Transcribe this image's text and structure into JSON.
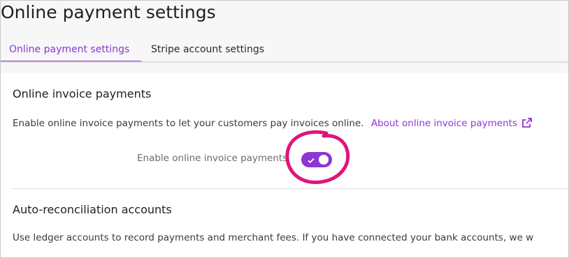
{
  "page": {
    "title": "Online payment settings"
  },
  "tabs": [
    {
      "label": "Online payment settings",
      "active": true
    },
    {
      "label": "Stripe account settings",
      "active": false
    }
  ],
  "online_invoice": {
    "title": "Online invoice payments",
    "description": "Enable online invoice payments to let your customers pay invoices online.",
    "link_text": "About online invoice payments",
    "link_icon": "external-link-icon",
    "toggle_label": "Enable online invoice payments",
    "toggle_on": true
  },
  "auto_reconciliation": {
    "title": "Auto-reconciliation accounts",
    "description": "Use ledger accounts to record payments and merchant fees. If you have connected your bank accounts, we w"
  },
  "colors": {
    "accent": "#8e35d6",
    "annotation": "#e0157a",
    "page_bg": "#f7f7f8",
    "card_bg": "#ffffff"
  }
}
